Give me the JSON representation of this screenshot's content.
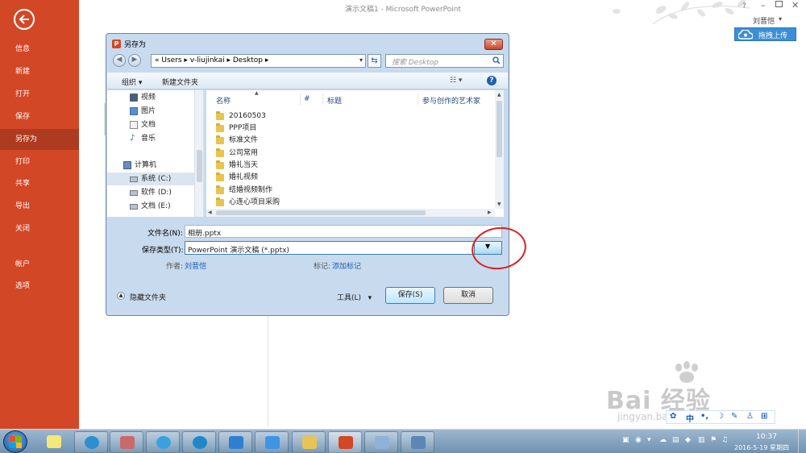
{
  "window": {
    "title": "演示文稿1 - Microsoft PowerPoint",
    "help": "?",
    "minimize": "–",
    "close": "✕",
    "user_name": "刘晋恺",
    "user_caret": "▾",
    "upload_label": "拖拽上传"
  },
  "sidebar": {
    "items": [
      {
        "label": "信息"
      },
      {
        "label": "新建"
      },
      {
        "label": "打开"
      },
      {
        "label": "保存"
      },
      {
        "label": "另存为"
      },
      {
        "label": "打印"
      },
      {
        "label": "共享"
      },
      {
        "label": "导出"
      },
      {
        "label": "关闭"
      },
      {
        "label": "帐户"
      },
      {
        "label": "选项"
      }
    ],
    "active_index": 4
  },
  "dialog": {
    "title": "另存为",
    "close": "✕",
    "address": {
      "crumbs": "«  Users  ▸  v-liujinkai  ▸  Desktop  ▸",
      "dropdown": "▾"
    },
    "search_placeholder": "搜索 Desktop",
    "toolbar": {
      "organize": "组织 ▾",
      "new_folder": "新建文件夹",
      "views": "☷ ▾",
      "help": "?"
    },
    "nav_items": [
      {
        "label": "视频",
        "icon": "video-icon"
      },
      {
        "label": "图片",
        "icon": "pictures-icon"
      },
      {
        "label": "文档",
        "icon": "documents-icon"
      },
      {
        "label": "音乐",
        "icon": "music-icon"
      },
      {
        "label": "计算机",
        "icon": "computer-icon"
      },
      {
        "label": "系统 (C:)",
        "icon": "drive-icon"
      },
      {
        "label": "软件 (D:)",
        "icon": "drive-icon"
      },
      {
        "label": "文档 (E:)",
        "icon": "drive-icon"
      }
    ],
    "columns": {
      "name": "名称",
      "number": "#",
      "title": "标题",
      "artist": "参与创作的艺术家"
    },
    "files": [
      {
        "name": "20160503"
      },
      {
        "name": "PPP项目"
      },
      {
        "name": "标准文件"
      },
      {
        "name": "公司常用"
      },
      {
        "name": "婚礼当天"
      },
      {
        "name": "婚礼视频"
      },
      {
        "name": "结婚视频制作"
      },
      {
        "name": "心连心项目采购"
      }
    ],
    "filename_label": "文件名(N):",
    "filename_value": "相册.pptx",
    "filetype_label": "保存类型(T):",
    "filetype_value": "PowerPoint 演示文稿 (*.pptx)",
    "author_label": "作者:",
    "author_value": "刘晋恺",
    "tags_label": "标记:",
    "tags_value": "添加标记",
    "hide_folders": "隐藏文件夹",
    "tools": "工具(L)",
    "tools_caret": "▾",
    "save": "保存(S)",
    "cancel": "取消"
  },
  "ime": {
    "items": [
      "中",
      "•,",
      "☽",
      "✎",
      "♙",
      "⊞"
    ]
  },
  "taskbar": {
    "time": "10:37",
    "date": "2016-5-19 星期四"
  },
  "watermark": {
    "text": "Bai 经验",
    "url": "jingyan.baidu.com"
  },
  "colors": {
    "accent": "#d24726",
    "accent_active": "#ac3b1f",
    "annotation": "#d92020"
  }
}
